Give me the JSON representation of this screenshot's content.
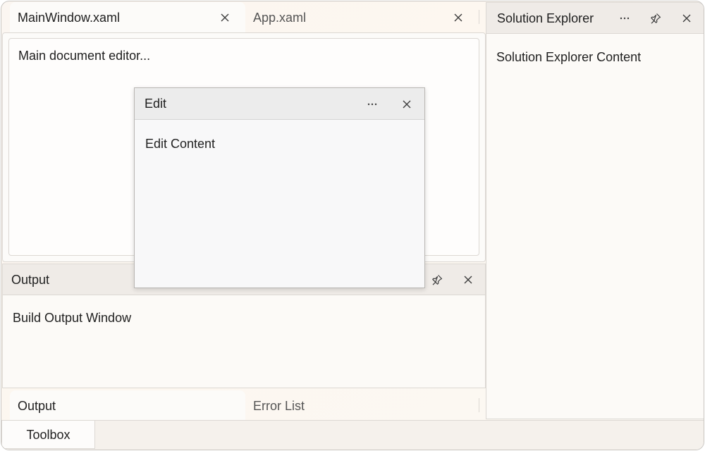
{
  "document_tabs": [
    {
      "label": "MainWindow.xaml",
      "active": true
    },
    {
      "label": "App.xaml",
      "active": false
    }
  ],
  "document": {
    "content": "Main document editor..."
  },
  "solution_explorer": {
    "title": "Solution Explorer",
    "content": "Solution Explorer Content"
  },
  "edit_window": {
    "title": "Edit",
    "content": "Edit Content"
  },
  "output_panel": {
    "title": "Output",
    "content": "Build Output Window"
  },
  "bottom_tabs": [
    {
      "label": "Output",
      "active": true
    },
    {
      "label": "Error List",
      "active": false
    }
  ],
  "side_bar": {
    "toolbox_label": "Toolbox"
  },
  "icons": {
    "close": "close-icon",
    "more": "more-options-icon",
    "pin": "pin-icon"
  }
}
